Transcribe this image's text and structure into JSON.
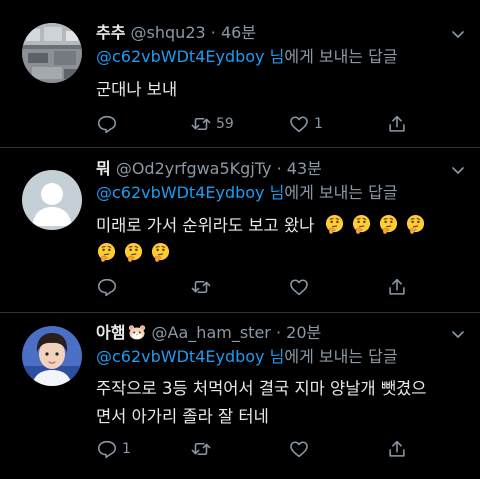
{
  "tweets": [
    {
      "name": "추추",
      "handle": "@shqu23",
      "separator": "·",
      "time": "46분",
      "reply_to": "@c62vbWDt4Eydboy",
      "reply_suffix_nim": " 님",
      "reply_suffix_rest": "에게 보내는 답글",
      "body_lines": [
        "군대나 보내"
      ],
      "retweet_count": "59",
      "like_count": "1",
      "reply_count": ""
    },
    {
      "name": "뭐",
      "handle": "@Od2yrfgwa5KgjTy",
      "separator": "·",
      "time": "43분",
      "reply_to": "@c62vbWDt4Eydboy",
      "reply_suffix_nim": " 님",
      "reply_suffix_rest": "에게 보내는 답글",
      "body_lines": [
        "미래로 가서 순위라도 보고 왔나"
      ],
      "line1_emoji": [
        "thinking-face",
        "thinking-face",
        "thinking-face",
        "thinking-face"
      ],
      "line2_emoji": [
        "thinking-face",
        "thinking-face",
        "thinking-face"
      ],
      "retweet_count": "",
      "like_count": "",
      "reply_count": ""
    },
    {
      "name": "아햄",
      "name_emoji": "hamster-face",
      "handle": "@Aa_ham_ster",
      "separator": "·",
      "time": "20분",
      "reply_to": "@c62vbWDt4Eydboy",
      "reply_suffix_nim": " 님",
      "reply_suffix_rest": "에게 보내는 답글",
      "body_lines": [
        "주작으로 3등 처먹어서 결국 지마 양날개 뺏겼으",
        "면서 아가리 졸라 잘 터네"
      ],
      "reply_count": "1",
      "retweet_count": "",
      "like_count": ""
    }
  ],
  "colors": {
    "background": "#000000",
    "text": "#e7e9ea",
    "muted": "#8b98a5",
    "link": "#1d9bf0",
    "divider": "#2f3336"
  }
}
